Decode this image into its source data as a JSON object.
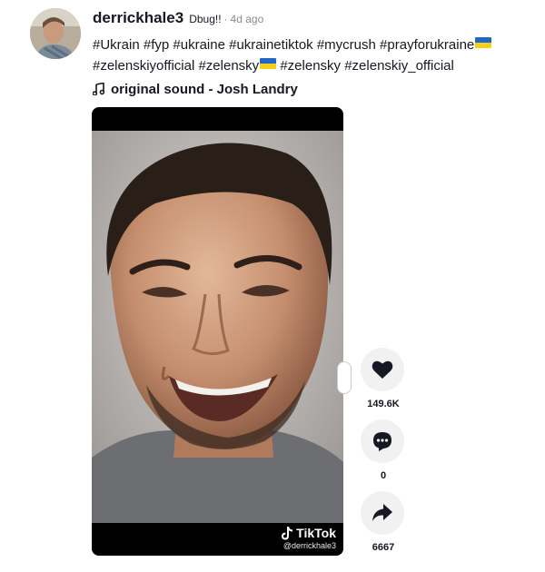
{
  "post": {
    "username": "derrickhale3",
    "nickname": "Dbug!!",
    "separator": "·",
    "time": "4d ago",
    "hashtags_line1": [
      "#Ukrain",
      "#fyp",
      "#ukraine",
      "#ukrainetiktok",
      "#mycrush",
      "#prayforukraine"
    ],
    "hashtags_line2": [
      "#zelenskiyofficial",
      "#zelensky",
      "#zelensky",
      "#zelenskiy_official"
    ],
    "flag_emoji": "ukraine-flag",
    "music": "original sound - Josh Landry"
  },
  "video": {
    "watermark_brand": "TikTok",
    "watermark_user": "@derrickhale3"
  },
  "actions": {
    "like": {
      "icon": "heart-icon",
      "count": "149.6K"
    },
    "comment": {
      "icon": "comment-icon",
      "count": "0"
    },
    "share": {
      "icon": "share-icon",
      "count": "6667"
    }
  },
  "colors": {
    "text": "#161823",
    "secondary": "#8a8b91",
    "action_bg": "#f1f1f2"
  }
}
